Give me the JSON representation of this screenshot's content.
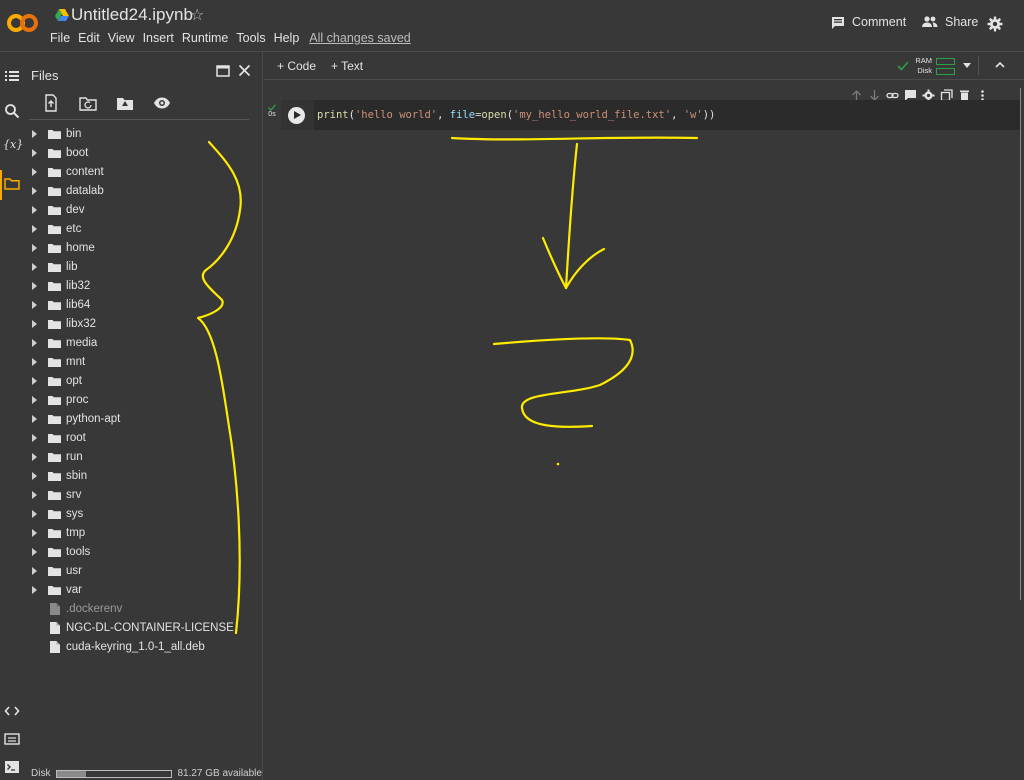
{
  "app": {
    "title": "Untitled24.ipynb",
    "menu": [
      "File",
      "Edit",
      "View",
      "Insert",
      "Runtime",
      "Tools",
      "Help"
    ],
    "saved_status": "All changes saved",
    "comment_label": "Comment",
    "share_label": "Share"
  },
  "files": {
    "title": "Files",
    "folders": [
      "bin",
      "boot",
      "content",
      "datalab",
      "dev",
      "etc",
      "home",
      "lib",
      "lib32",
      "lib64",
      "libx32",
      "media",
      "mnt",
      "opt",
      "proc",
      "python-apt",
      "root",
      "run",
      "sbin",
      "srv",
      "sys",
      "tmp",
      "tools",
      "usr",
      "var"
    ],
    "files": [
      ".dockerenv",
      "NGC-DL-CONTAINER-LICENSE",
      "cuda-keyring_1.0-1_all.deb"
    ],
    "disk_label": "Disk",
    "disk_available": "81.27 GB available",
    "disk_used_fraction": 0.25
  },
  "notebook": {
    "add_code": "+ Code",
    "add_text": "+ Text",
    "ram_label": "RAM",
    "disk_label": "Disk",
    "cell_status_time": "0s",
    "code_text": "print('hello world', file=open('my_hello_world_file.txt', 'w'))"
  },
  "colors": {
    "brand_orange": "#f9ab00",
    "annotation_yellow": "#ffeb00",
    "status_green": "#2e9d47"
  }
}
